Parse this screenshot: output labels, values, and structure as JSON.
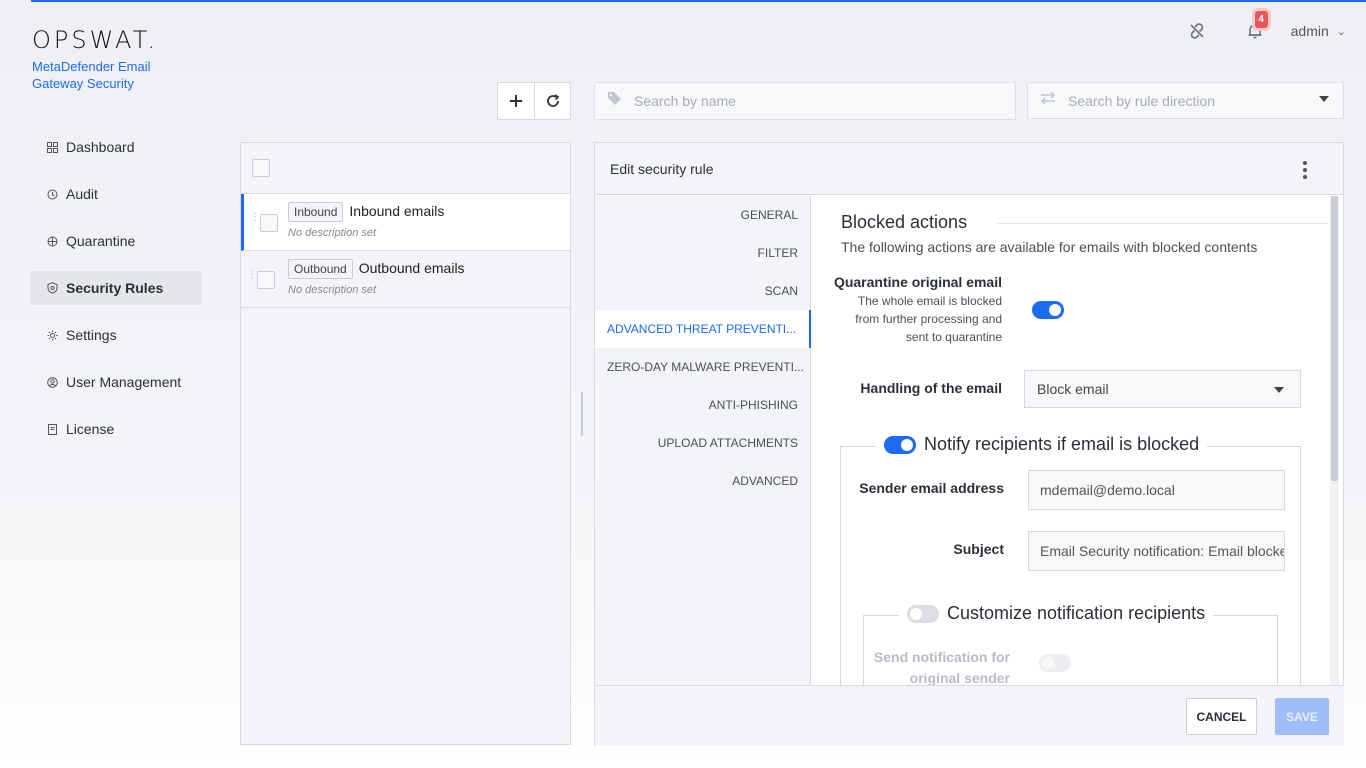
{
  "brand": {
    "logo": "OPSWAT.",
    "product": "MetaDefender Email Gateway Security"
  },
  "header": {
    "notification_count": "4",
    "user": "admin"
  },
  "nav": {
    "items": [
      {
        "label": "Dashboard",
        "icon": "grid-icon"
      },
      {
        "label": "Audit",
        "icon": "audit-icon"
      },
      {
        "label": "Quarantine",
        "icon": "quarantine-icon"
      },
      {
        "label": "Security Rules",
        "icon": "shield-icon",
        "active": true
      },
      {
        "label": "Settings",
        "icon": "gear-icon"
      },
      {
        "label": "User Management",
        "icon": "user-icon"
      },
      {
        "label": "License",
        "icon": "license-icon"
      }
    ]
  },
  "search": {
    "name_placeholder": "Search by name",
    "direction_placeholder": "Search by rule direction"
  },
  "rules": [
    {
      "tag": "Inbound",
      "name": "Inbound emails",
      "description": "No description set",
      "selected": true
    },
    {
      "tag": "Outbound",
      "name": "Outbound emails",
      "description": "No description set",
      "selected": false
    }
  ],
  "panel": {
    "title": "Edit security rule",
    "tabs": [
      "GENERAL",
      "FILTER",
      "SCAN",
      "ADVANCED THREAT PREVENTI...",
      "ZERO-DAY MALWARE PREVENTI...",
      "ANTI-PHISHING",
      "UPLOAD ATTACHMENTS",
      "ADVANCED"
    ],
    "active_tab": "ADVANCED THREAT PREVENTI...",
    "section_title": "Blocked actions",
    "section_subtitle": "The following actions are available for emails with blocked contents",
    "quarantine_label": "Quarantine original email",
    "quarantine_desc_1": "The whole email is blocked",
    "quarantine_desc_2": "from further processing and",
    "quarantine_desc_3": "sent to quarantine",
    "quarantine_on": true,
    "handling_label": "Handling of the email",
    "handling_value": "Block email",
    "notify_label": "Notify recipients if email is blocked",
    "notify_on": true,
    "sender_label": "Sender email address",
    "sender_value": "mdemail@demo.local",
    "subject_label": "Subject",
    "subject_value": "Email Security notification: Email blocked",
    "customize_label": "Customize notification recipients",
    "customize_on": false,
    "send_label_1": "Send notification for",
    "send_label_2": "original sender",
    "cancel": "CANCEL",
    "save": "SAVE"
  }
}
